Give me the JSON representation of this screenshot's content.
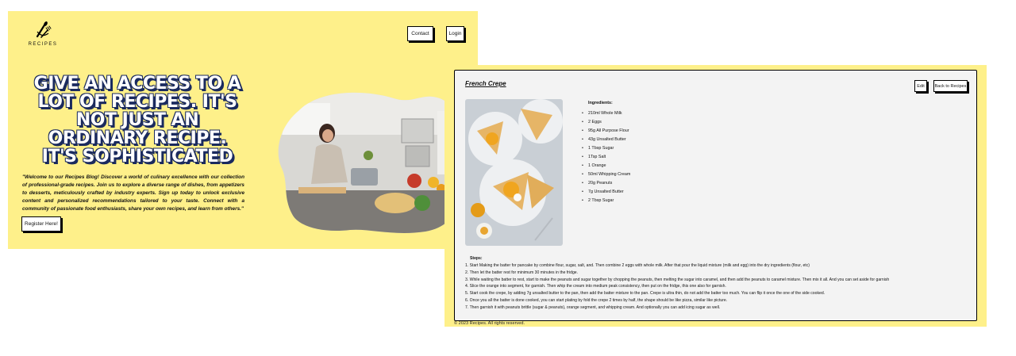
{
  "landing": {
    "logo_text": "RECIPES",
    "nav": {
      "contact_label": "Contact",
      "login_label": "Login"
    },
    "hero_title_lines": [
      "GIVE AN ACCESS TO A",
      "LOT OF RECIPES. IT'S",
      "NOT JUST AN",
      "ORDINARY RECIPE.",
      "IT'S SOPHISTICATED"
    ],
    "hero_description": "\"Welcome to our Recipes Blog! Discover a world of culinary excellence with our collection of professional-grade recipes. Join us to explore a diverse range of dishes, from appetizers to desserts, meticulously crafted by industry experts. Sign up today to unlock exclusive content and personalized recommendations tailored to your taste. Connect with a community of passionate food enthusiasts, share your own recipes, and learn from others.\"",
    "register_label": "Register Here!"
  },
  "detail": {
    "recipe_title": "French Crepe",
    "edit_label": "Edit",
    "back_label": "Back to Recipes",
    "ingredients_title": "Ingredients:",
    "ingredients": [
      "210ml Whole Milk",
      "2 Eggs",
      "95g All Purpose Flour",
      "43g Unsalted Butter",
      "1 Tbsp Sugar",
      "1Tsp Salt",
      "1 Orange",
      "50ml Whipping Cream",
      "20g Peanuts",
      "7g Unsalted Butter",
      "2 Tbsp Sugar"
    ],
    "steps_title": "Steps:",
    "steps": [
      "1. Start Making the batter for pancake by combine flour, sugar, salt, and. Then combine 2 eggs with whole milk. After that pour the liquid mixture (milk and egg) into the dry ingredients (flour, etc)",
      "2. Then let the batter rest for minimum 30 minutes in the fridge.",
      "3. While waiting the batter to rest, start to make the peanuts and sugar together by chopping the peanuts, then melting the sugar into caramel, and then add the peanuts to caramel mixture. Then mix it all. And you can set aside for garnish",
      "4. Slice the orange into segment, for garnish. Then whip the cream into medium peak consistency, then put on the fridge, this one also for garnish.",
      "5. Start cook the crepe, by adding 7g unsalted butter to the pan, then add the batter mixture to the pan. Crepe is ultra thin, do not add the batter too much. You can flip it once the one of the side cooked.",
      "6. Once you all the batter is done cooked, you can start plating by fold the crepe 2 times by half, the shape should be like pizza, similar like picture.",
      "7. Then garnish it with peanuts brittle (sugar & peanuts), orange segment, and whipping cream. And optionally you can add icing sugar as well."
    ],
    "footer": "© 2023 Recipes. All rights reserved."
  }
}
